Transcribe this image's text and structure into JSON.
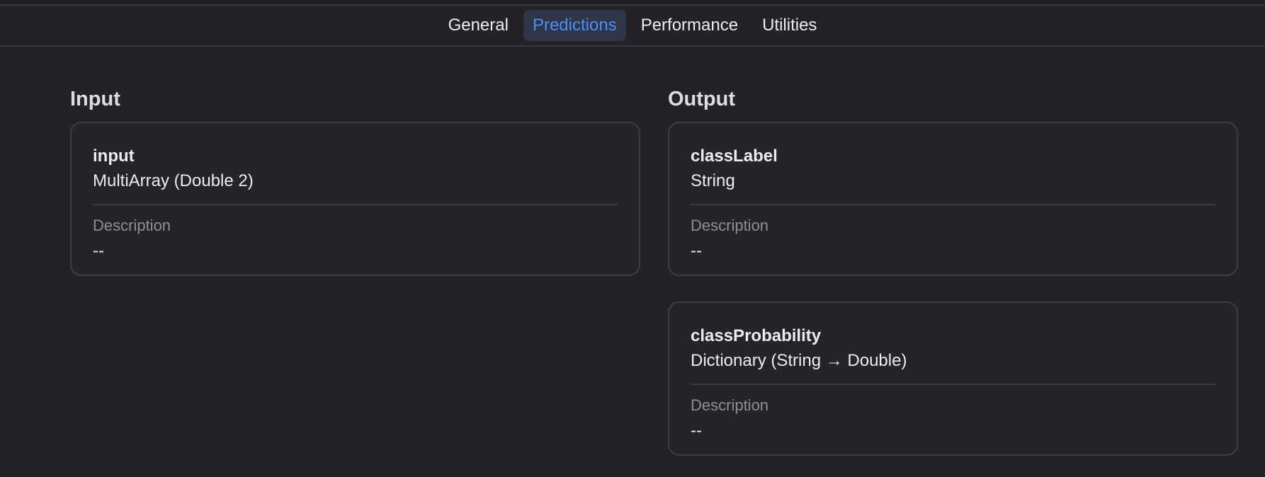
{
  "tabs": [
    {
      "label": "General",
      "active": false
    },
    {
      "label": "Predictions",
      "active": true
    },
    {
      "label": "Performance",
      "active": false
    },
    {
      "label": "Utilities",
      "active": false
    }
  ],
  "input": {
    "title": "Input",
    "features": [
      {
        "name": "input",
        "type": "MultiArray (Double 2)",
        "description_label": "Description",
        "description": "--"
      }
    ]
  },
  "output": {
    "title": "Output",
    "features": [
      {
        "name": "classLabel",
        "type": "String",
        "description_label": "Description",
        "description": "--"
      },
      {
        "name": "classProbability",
        "type": "Dictionary (String → Double)",
        "description_label": "Description",
        "description": "--"
      }
    ]
  },
  "colors": {
    "background": "#242227",
    "accent": "#4e8cf7",
    "active_tab_bg": "#2f3648",
    "card_border": "#3e3d42"
  }
}
